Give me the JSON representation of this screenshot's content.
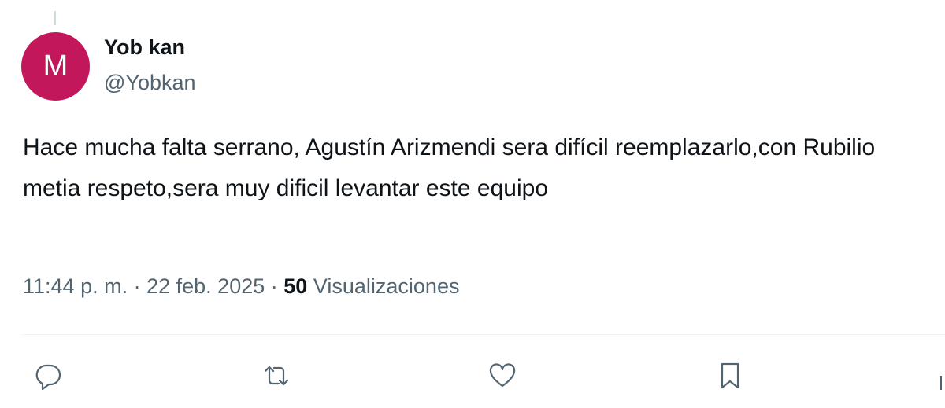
{
  "tweet": {
    "avatar_letter": "M",
    "avatar_color": "#c2185b",
    "display_name": "Yob kan",
    "handle": "@Yobkan",
    "text": "Hace mucha falta serrano, Agustín Arizmendi sera difícil reemplazarlo,con Rubilio metia respeto,sera muy dificil levantar este equipo",
    "time": "11:44 p. m.",
    "separator": "·",
    "date": "22 feb. 2025",
    "views_count": "50",
    "views_label": "Visualizaciones"
  },
  "actions": [
    {
      "name": "reply",
      "icon": "reply-icon"
    },
    {
      "name": "repost",
      "icon": "repost-icon"
    },
    {
      "name": "like",
      "icon": "heart-icon"
    },
    {
      "name": "bookmark",
      "icon": "bookmark-icon"
    },
    {
      "name": "share",
      "icon": "share-icon"
    }
  ],
  "colors": {
    "text_primary": "#0f1419",
    "text_secondary": "#536471",
    "divider": "#eff3f4"
  }
}
